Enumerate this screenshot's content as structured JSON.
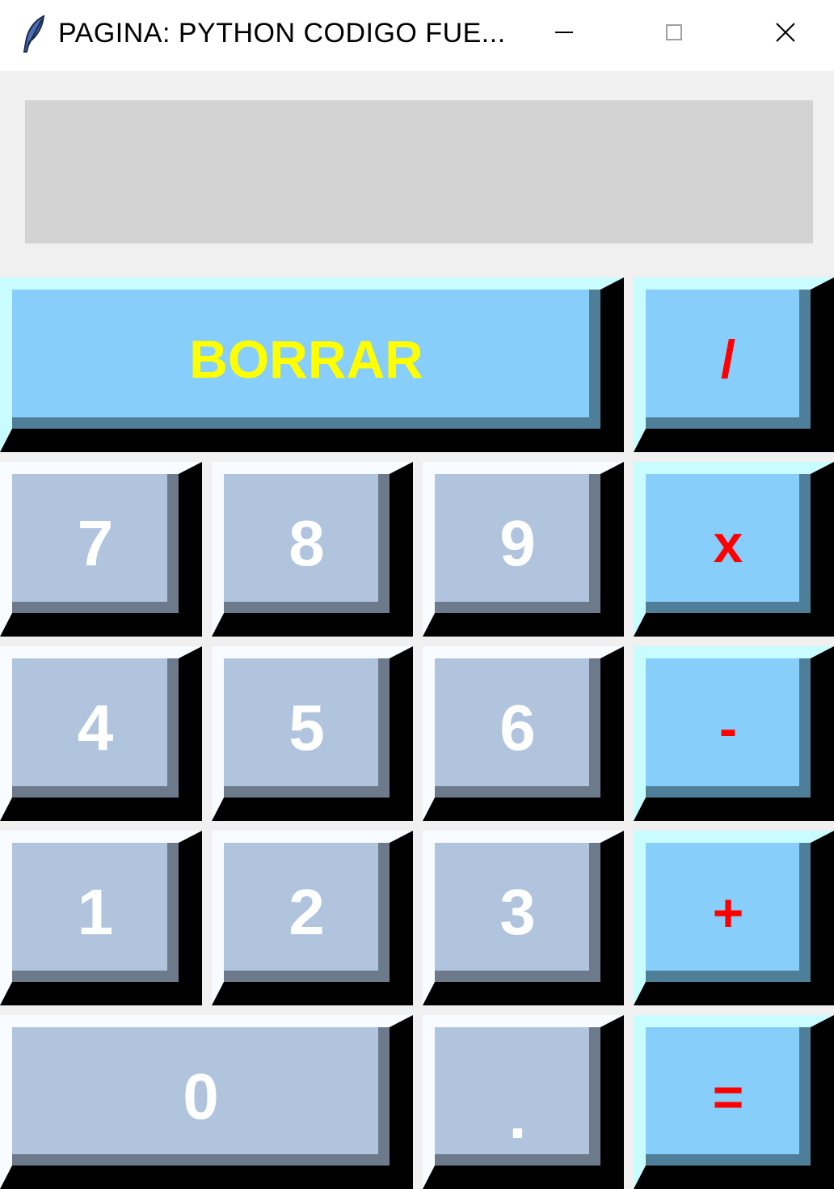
{
  "window": {
    "title": "PAGINA:  PYTHON  CODIGO  FUE...",
    "icon": "feather-icon",
    "minimize_glyph": "—",
    "maximize_glyph": "☐",
    "close_glyph": "✕"
  },
  "display": {
    "value": ""
  },
  "buttons": {
    "clear": "BORRAR",
    "divide": "/",
    "multiply": "x",
    "subtract": "-",
    "add": "+",
    "equals": "=",
    "seven": "7",
    "eight": "8",
    "nine": "9",
    "four": "4",
    "five": "5",
    "six": "6",
    "one": "1",
    "two": "2",
    "three": "3",
    "zero": "0",
    "decimal": "."
  },
  "colors": {
    "number_button_bg": "#b0c4de",
    "number_button_text": "#ffffff",
    "operator_button_bg": "#87cefa",
    "operator_button_text": "#ff0000",
    "clear_button_text": "#ffff00",
    "display_bg": "#d3d3d3"
  }
}
